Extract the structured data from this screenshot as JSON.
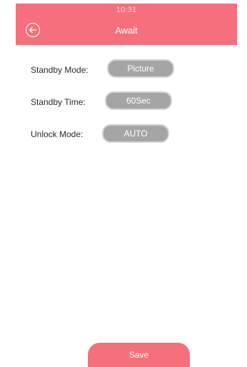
{
  "status_bar": {
    "time": "10:31"
  },
  "header": {
    "title": "Await",
    "back_icon": "back-arrow-circle-icon"
  },
  "settings": [
    {
      "label": "Standby Mode:",
      "value": "Picture"
    },
    {
      "label": "Standby Time:",
      "value": "60Sec"
    },
    {
      "label": "Unlock Mode:",
      "value": "AUTO"
    }
  ],
  "footer": {
    "save_label": "Save"
  },
  "colors": {
    "accent": "#f56f7c",
    "pill_fill": "#a5a5a5",
    "pill_border": "#d3d3d3",
    "label_text": "#2a2a2a"
  }
}
